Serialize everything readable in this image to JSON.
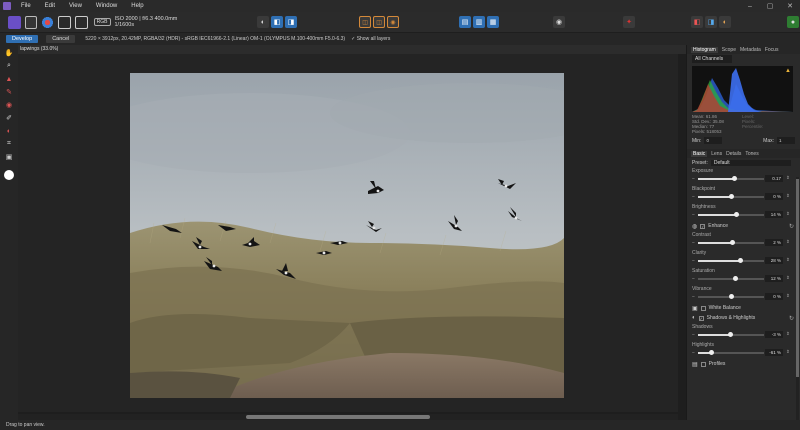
{
  "menubar": {
    "items": [
      "File",
      "Edit",
      "View",
      "Window",
      "Help"
    ]
  },
  "toolbar": {
    "badge": "RGB",
    "info": "ISO 2000 | f/6.3 400.0mm 1/1600s"
  },
  "context": {
    "develop": "Develop",
    "cancel": "Cancel",
    "info": "5220 × 3912px, 20.42MP, RGBA/32 (HDR) - sRGB IEC61966-2.1 (Linear)     OM-1 (OLYMPUS M.100-400mm F5.0-6.3)",
    "show_layers": "✓ Show all layers"
  },
  "document": {
    "tab": "lapwings (33.0%)"
  },
  "histogram_panel": {
    "tabs": [
      "Histogram",
      "Scope",
      "Metadata",
      "Focus"
    ],
    "channel": "All Channels",
    "stats_left": [
      "Mean: 61.86",
      "Std. Dev.: 35.08",
      "Median: 77",
      "Pixels: 518053"
    ],
    "stats_right": [
      "Level:",
      "Pixels:",
      "Percentile:"
    ],
    "min_label": "Min:",
    "min_value": "0",
    "max_label": "Max:",
    "max_value": "1"
  },
  "adjust_panel": {
    "tabs": [
      "Basic",
      "Lens",
      "Details",
      "Tones"
    ],
    "preset_label": "Preset:",
    "preset_value": "Default",
    "exposure": {
      "label": "Exposure",
      "value": "0.17",
      "pos": 0.54
    },
    "blackpoint": {
      "label": "Blackpoint",
      "value": "0 %",
      "pos": 0.5
    },
    "brightness": {
      "label": "Brightness",
      "value": "14 %",
      "pos": 0.57
    },
    "enhance": "Enhance",
    "contrast": {
      "label": "Contrast",
      "value": "2 %",
      "pos": 0.51
    },
    "clarity": {
      "label": "Clarity",
      "value": "28 %",
      "pos": 0.64
    },
    "saturation": {
      "label": "Saturation",
      "value": "12 %",
      "pos": 0.56
    },
    "vibrance": {
      "label": "Vibrance",
      "value": "0 %",
      "pos": 0.5
    },
    "white_balance": "White Balance",
    "shadows_highlights": "Shadows & Highlights",
    "shadows": {
      "label": "Shadows",
      "value": "-3 %",
      "pos": 0.48
    },
    "highlights": {
      "label": "Highlights",
      "value": "-61 %",
      "pos": 0.2
    },
    "profiles": "Profiles"
  },
  "status": {
    "text": "Drag to pan view."
  }
}
